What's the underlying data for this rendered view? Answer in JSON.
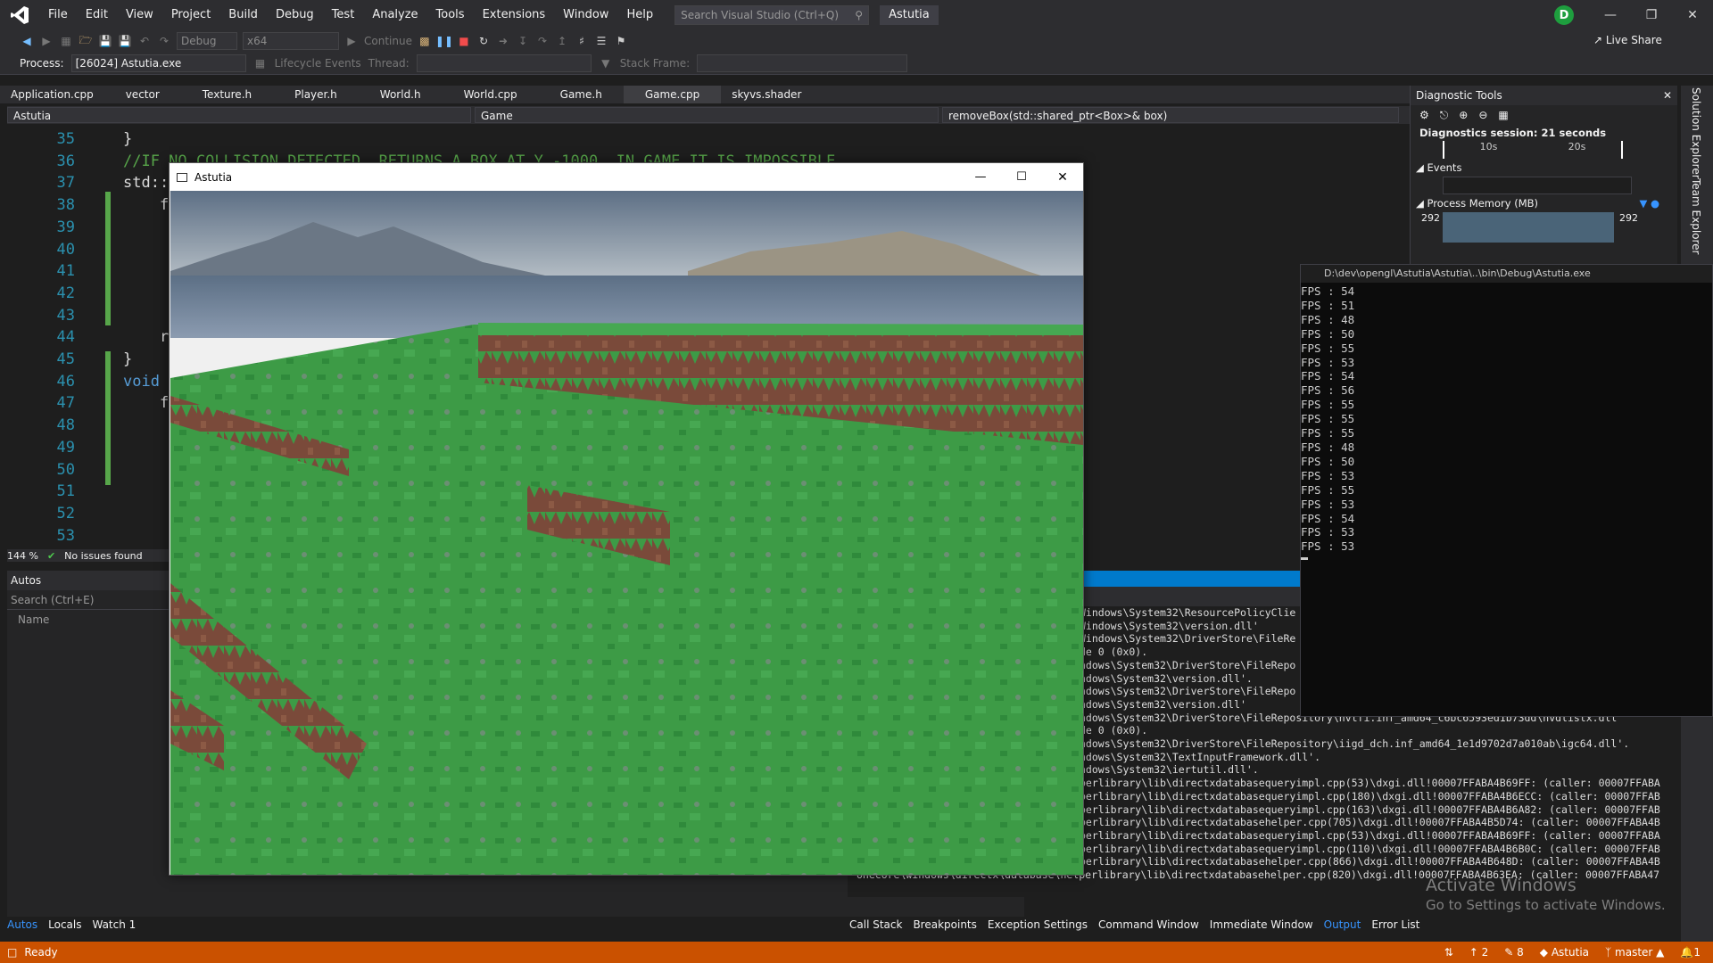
{
  "menubar": {
    "items": [
      "File",
      "Edit",
      "View",
      "Project",
      "Build",
      "Debug",
      "Test",
      "Analyze",
      "Tools",
      "Extensions",
      "Window",
      "Help"
    ],
    "search_placeholder": "Search Visual Studio (Ctrl+Q)",
    "solution_name": "Astutia",
    "user_initial": "D"
  },
  "toolbar": {
    "config": "Debug",
    "platform": "x64",
    "continue_label": "Continue",
    "live_share": "Live Share"
  },
  "processbar": {
    "process_label": "Process:",
    "process_value": "[26024] Astutia.exe",
    "lifecycle_label": "Lifecycle Events",
    "thread_label": "Thread:",
    "stack_label": "Stack Frame:"
  },
  "tabs": [
    "Application.cpp",
    "vector",
    "Texture.h",
    "Player.h",
    "World.h",
    "World.cpp",
    "Game.h",
    "Game.cpp",
    "skyvs.shader"
  ],
  "navbar": {
    "project": "Astutia",
    "scope": "Game",
    "member": "removeBox(std::shared_ptr<Box>& box)"
  },
  "editor": {
    "lines": [
      {
        "n": "35",
        "code": "}"
      },
      {
        "n": "36",
        "code": "//IF NO COLLISION DETECTED, RETURNS A BOX AT Y -1000, IN GAME IT IS IMPOSSIBLE"
      },
      {
        "n": "37",
        "code": "std::"
      },
      {
        "n": "38",
        "code": "    f"
      },
      {
        "n": "39",
        "code": ""
      },
      {
        "n": "40",
        "code": ""
      },
      {
        "n": "41",
        "code": ""
      },
      {
        "n": "42",
        "code": ""
      },
      {
        "n": "43",
        "code": ""
      },
      {
        "n": "44",
        "code": "    r"
      },
      {
        "n": "45",
        "code": "}"
      },
      {
        "n": "46",
        "code": "void"
      },
      {
        "n": "47",
        "code": "    f"
      },
      {
        "n": "48",
        "code": ""
      },
      {
        "n": "49",
        "code": ""
      },
      {
        "n": "50",
        "code": ""
      },
      {
        "n": "51",
        "code": ""
      },
      {
        "n": "52",
        "code": ""
      },
      {
        "n": "53",
        "code": ""
      }
    ],
    "zoom": "144 %",
    "issues": "No issues found"
  },
  "autos": {
    "title": "Autos",
    "search_placeholder": "Search (Ctrl+E)",
    "col_name": "Name"
  },
  "bottom_tabs_left": [
    "Autos",
    "Locals",
    "Watch 1"
  ],
  "bottom_tabs_right": [
    "Call Stack",
    "Breakpoints",
    "Exception Settings",
    "Command Window",
    "Immediate Window",
    "Output",
    "Error List"
  ],
  "output_lines": [
    "Windows\\System32\\ResourcePolicyClie",
    "Windows\\System32\\version.dll'",
    "Windows\\System32\\DriverStore\\FileRe",
    "de 0 (0x0).",
    "ndows\\System32\\DriverStore\\FileRepo",
    "ndows\\System32\\version.dll'.",
    "ndows\\System32\\DriverStore\\FileRepo",
    "ndows\\System32\\version.dll'",
    "ndows\\System32\\DriverStore\\FileRepository\\nvtfi.inf_amd64_c6bc6593ed1b73dd\\nvdlistx.dll'",
    "de 0 (0x0).",
    "ndows\\System32\\DriverStore\\FileRepository\\iigd_dch.inf_amd64_1e1d9702d7a010ab\\igc64.dll'.",
    "ndows\\System32\\TextInputFramework.dll'.",
    "ndows\\System32\\iertutil.dll'.",
    "perlibrary\\lib\\directxdatabasequeryimpl.cpp(53)\\dxgi.dll!00007FFABA4B69FF: (caller: 00007FFABA",
    "perlibrary\\lib\\directxdatabasequeryimpl.cpp(180)\\dxgi.dll!00007FFABA4B6ECC: (caller: 00007FFAB",
    "perlibrary\\lib\\directxdatabasequeryimpl.cpp(163)\\dxgi.dll!00007FFABA4B6A82: (caller: 00007FFAB",
    "perlibrary\\lib\\directxdatabasehelper.cpp(705)\\dxgi.dll!00007FFABA4B5D74: (caller: 00007FFABA4B",
    "perlibrary\\lib\\directxdatabasequeryimpl.cpp(53)\\dxgi.dll!00007FFABA4B69FF: (caller: 00007FFABA",
    "perlibrary\\lib\\directxdatabasequeryimpl.cpp(110)\\dxgi.dll!00007FFABA4B6B0C: (caller: 00007FFAB",
    "perlibrary\\lib\\directxdatabasehelper.cpp(866)\\dxgi.dll!00007FFABA4B648D: (caller: 00007FFABA4B",
    "onecore\\windows\\directx\\database\\helperlibrary\\lib\\directxdatabasehelper.cpp(820)\\dxgi.dll!00007FFABA4B63EA: (caller: 00007FFABA47"
  ],
  "activate_windows": {
    "line1": "Activate Windows",
    "line2": "Go to Settings to activate Windows."
  },
  "diagnostics": {
    "title": "Diagnostic Tools",
    "session": "Diagnostics session: 21 seconds",
    "tick1": "10s",
    "tick2": "20s",
    "events_label": "Events",
    "memory_label": "Process Memory (MB)",
    "mem_left": "292",
    "mem_right": "292"
  },
  "side_tabs": [
    "Solution Explorer",
    "Team Explorer"
  ],
  "console": {
    "title": "D:\\dev\\opengl\\Astutia\\Astutia\\..\\bin\\Debug\\Astutia.exe",
    "fps_lines": [
      "FPS : 54",
      "FPS : 51",
      "FPS : 48",
      "FPS : 50",
      "FPS : 55",
      "FPS : 53",
      "FPS : 54",
      "FPS : 56",
      "FPS : 55",
      "FPS : 55",
      "FPS : 55",
      "FPS : 48",
      "FPS : 50",
      "FPS : 53",
      "FPS : 55",
      "FPS : 53",
      "FPS : 54",
      "FPS : 53",
      "FPS : 53"
    ]
  },
  "gamewindow": {
    "title": "Astutia"
  },
  "statusbar": {
    "ready": "Ready",
    "up_count": "2",
    "edit_count": "8",
    "repo": "Astutia",
    "branch": "master",
    "notif": "1"
  },
  "colors": {
    "accent": "#007acc",
    "status_debug": "#ca5100",
    "grass": "#3b9a45",
    "dirt": "#7a4a3a"
  }
}
